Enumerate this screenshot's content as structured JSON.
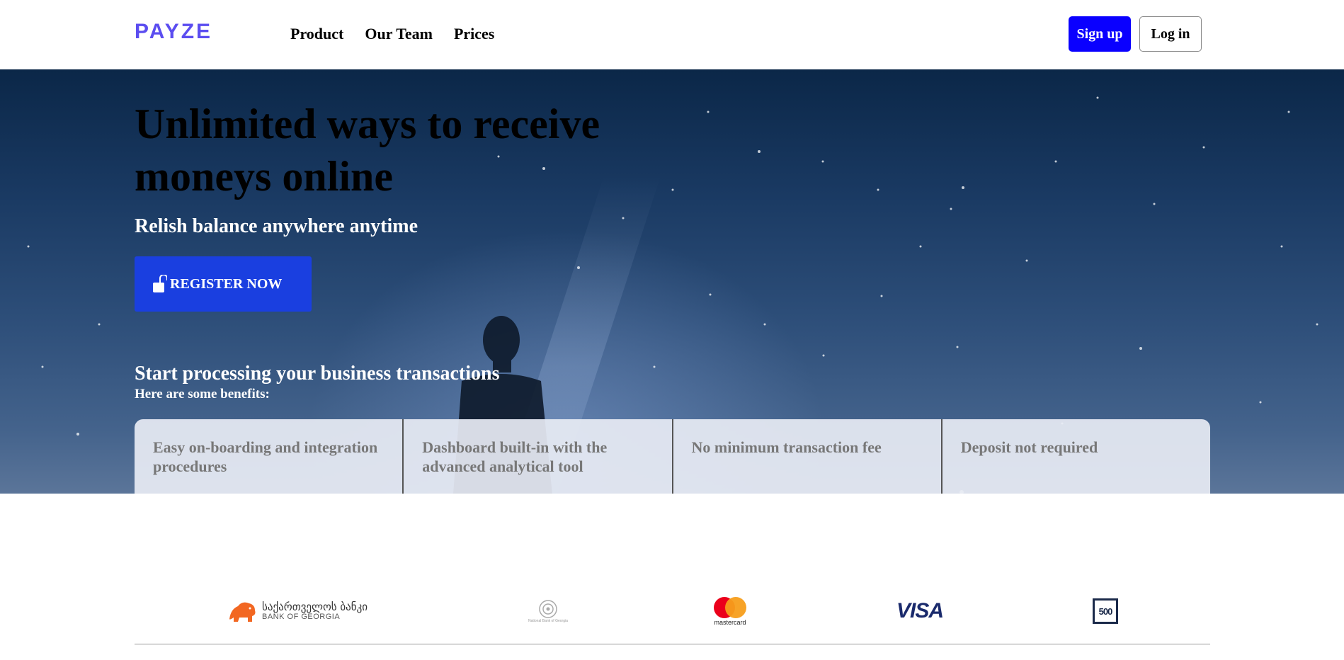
{
  "header": {
    "logo_text": "PAYZE",
    "brand_color": "#5b4df0",
    "nav": [
      "Product",
      "Our Team",
      "Prices"
    ],
    "signup_label": "Sign up",
    "login_label": "Log in"
  },
  "hero": {
    "title": "Unlimited ways to receive moneys online",
    "subtitle": "Relish balance anywhere anytime",
    "register_label": "REGISTER NOW",
    "register_icon": "unlock-icon",
    "benefits_title": "Start processing your business transactions",
    "benefits_subtitle": "Here are some benefits:",
    "benefits": [
      "Easy on-boarding and integration procedures",
      "Dashboard built-in with the advanced analytical tool",
      "No minimum transaction fee",
      "Deposit not required"
    ]
  },
  "partners": {
    "bog_georgian": "საქართველოს ბანკი",
    "bog_english": "BANK OF GEORGIA",
    "nbg_label": "National Bank of Georgia",
    "mastercard_label": "mastercard",
    "visa_label": "VISA",
    "f500_label": "500"
  },
  "colors": {
    "primary_button": "#0a00ff",
    "register_button": "#1a3fe0",
    "mastercard_red": "#eb001b",
    "mastercard_orange": "#f79e1b",
    "bog_orange": "#f26722"
  }
}
